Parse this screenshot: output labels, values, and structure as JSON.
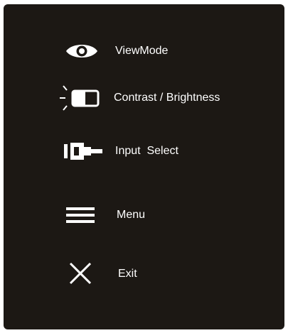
{
  "osd": {
    "background_color": "#1c1814",
    "text_color": "#ffffff",
    "items": [
      {
        "label": "ViewMode",
        "icon": "eye-icon"
      },
      {
        "label": "Contrast / Brightness",
        "icon": "contrast-brightness-icon"
      },
      {
        "label": "Input  Select",
        "icon": "input-connector-icon"
      },
      {
        "label": "Menu",
        "icon": "hamburger-menu-icon"
      },
      {
        "label": "Exit",
        "icon": "close-icon"
      }
    ]
  }
}
